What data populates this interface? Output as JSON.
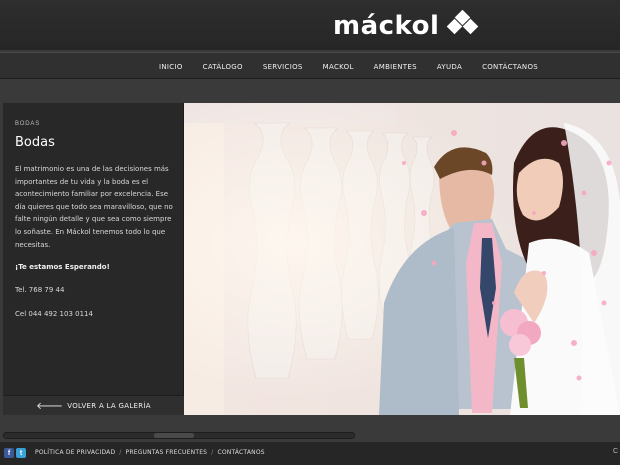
{
  "header": {
    "logo_text": "máckol"
  },
  "nav": {
    "items": [
      "INICIO",
      "CATÁLOGO",
      "SERVICIOS",
      "MACKOL",
      "AMBIENTES",
      "AYUDA",
      "CONTÁCTANOS"
    ]
  },
  "sidebar": {
    "breadcrumb": "BODAS",
    "title": "Bodas",
    "description": "El matrimonio es una de las decisiones más importantes de tu vida y la boda es el acontecimiento familiar por excelencia. Ese día quieres que todo sea maravilloso, que no falte ningún detalle y que sea como siempre lo soñaste. En Máckol tenemos todo lo que necesitas.",
    "tagline": "¡Te estamos Esperando!",
    "tel": "Tel. 768 79 44",
    "cel": "Cel 044 492 103 0114",
    "back_label": "VOLVER A LA GALERÍA",
    "back_arrow": "🡐"
  },
  "footer": {
    "fb": "f",
    "tw": "t",
    "links": [
      "POLÍTICA DE PRIVACIDAD",
      "PREGUNTAS FRECUENTES",
      "CONTÁCTANOS"
    ],
    "separator": "/",
    "right_char": "C"
  },
  "colors": {
    "background": "#3a3a3a",
    "header": "#262626",
    "sidebar": "#282828",
    "facebook": "#3b5998",
    "twitter": "#3aa0d8"
  },
  "icons": [
    "diamond-logo-icon",
    "arrow-left-icon",
    "facebook-icon",
    "twitter-icon"
  ]
}
